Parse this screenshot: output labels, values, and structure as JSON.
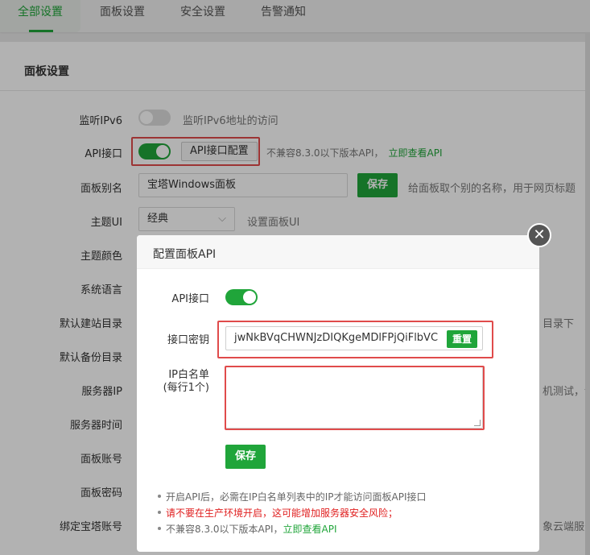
{
  "tabs": [
    {
      "label": "全部设置",
      "active": true
    },
    {
      "label": "面板设置",
      "active": false
    },
    {
      "label": "安全设置",
      "active": false
    },
    {
      "label": "告警通知",
      "active": false
    }
  ],
  "section_title": "面板设置",
  "rows": {
    "ipv6": {
      "label": "监听IPv6",
      "hint": "监听IPv6地址的访问",
      "enabled": false
    },
    "api": {
      "label": "API接口",
      "button": "API接口配置",
      "hint": "不兼容8.3.0以下版本API，",
      "link": "立即查看API",
      "enabled": true
    },
    "alias": {
      "label": "面板别名",
      "value": "宝塔Windows面板",
      "save": "保存",
      "hint": "给面板取个别的名称，用于网页标题"
    },
    "theme": {
      "label": "主题UI",
      "value": "经典",
      "hint": "设置面板UI"
    },
    "color": {
      "label": "主题颜色"
    },
    "language": {
      "label": "系统语言"
    },
    "site_dir": {
      "label": "默认建站目录",
      "hint_tail": "目录下"
    },
    "backup_dir": {
      "label": "默认备份目录"
    },
    "server_ip": {
      "label": "服务器IP",
      "hint_tail": "机测试，请"
    },
    "server_time": {
      "label": "服务器时间"
    },
    "account": {
      "label": "面板账号"
    },
    "password": {
      "label": "面板密码"
    },
    "bt_account": {
      "label": "绑定宝塔账号",
      "hint_tail": "象云端服务(说"
    }
  },
  "modal": {
    "title": "配置面板API",
    "close_glyph": "✕",
    "api_label": "API接口",
    "api_enabled": true,
    "key_label": "接口密钥",
    "key_value": "jwNkBVqCHWNJzDIQKgeMDlFPjQiFlbVC",
    "reset_label": "重置",
    "whitelist_label_1": "IP白名单",
    "whitelist_label_2": "(每行1个)",
    "whitelist_value": "",
    "save_label": "保存",
    "notes": [
      "开启API后，必需在IP白名单列表中的IP才能访问面板API接口",
      "请不要在生产环境开启，这可能增加服务器安全风险；",
      "不兼容8.3.0以下版本API，"
    ],
    "notes_link": "立即查看API"
  },
  "colors": {
    "accent": "#20a53a",
    "highlight_border": "#e04b4b",
    "warning_text": "#e02020"
  }
}
